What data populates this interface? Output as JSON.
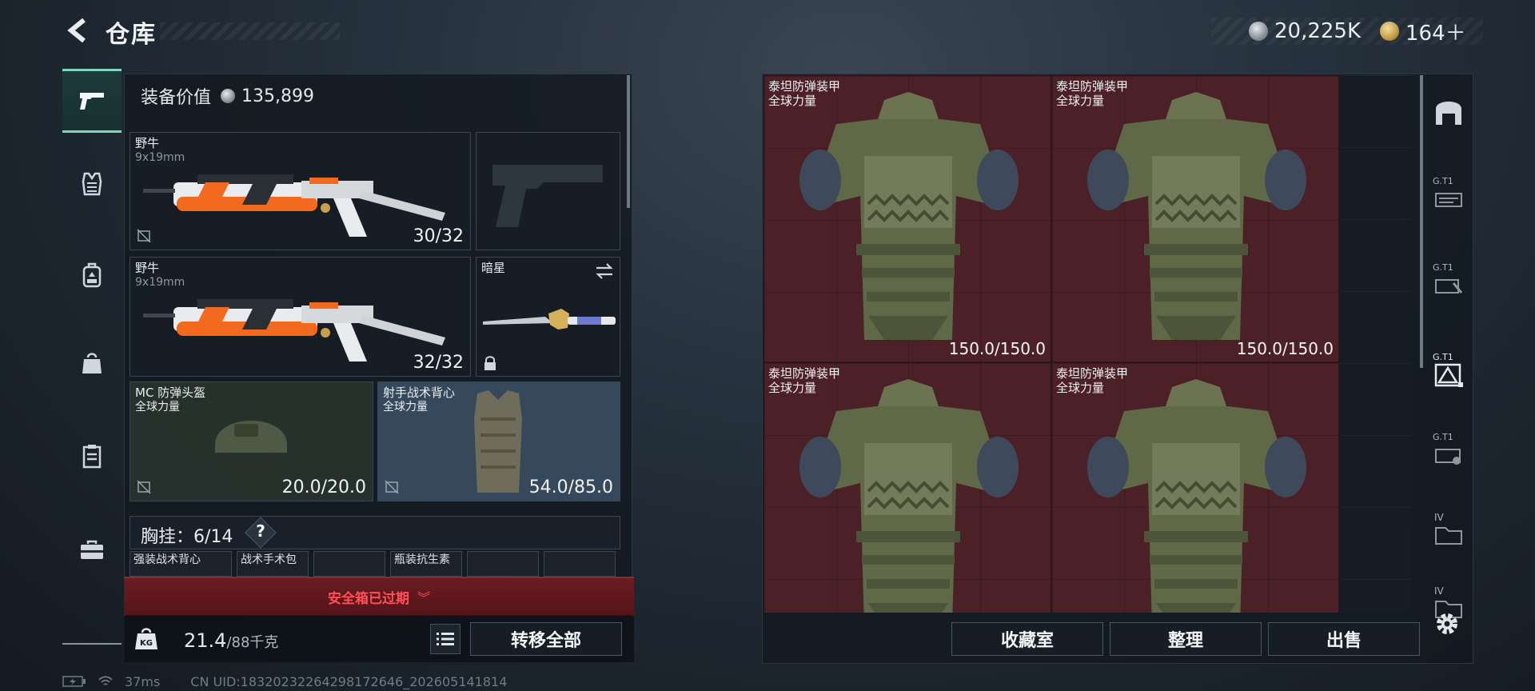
{
  "header": {
    "title": "仓库",
    "currency_primary": "20,225K",
    "currency_secondary": "164＋"
  },
  "left_nav": [
    {
      "name": "weapons-tab",
      "icon": "pistol-icon",
      "active": true
    },
    {
      "name": "armor-tab",
      "icon": "vest-icon",
      "active": false
    },
    {
      "name": "backpack-tab",
      "icon": "backpack-icon",
      "active": false
    },
    {
      "name": "bag-tab",
      "icon": "bag-icon",
      "active": false
    },
    {
      "name": "container-tab",
      "icon": "container-icon",
      "active": false
    },
    {
      "name": "toolbox-tab",
      "icon": "toolbox-icon",
      "active": false
    }
  ],
  "equipment": {
    "value_label": "装备价值",
    "value": "135,899",
    "primary_weapon": {
      "name": "野牛",
      "caliber": "9x19mm",
      "ammo": "30/32"
    },
    "secondary_weapon": {
      "name": "野牛",
      "caliber": "9x19mm",
      "ammo": "32/32"
    },
    "melee": {
      "name": "暗星"
    },
    "helmet": {
      "name": "MC 防弹头盔",
      "brand": "全球力量",
      "durability": "20.0/20.0"
    },
    "armor": {
      "name": "射手战术背心",
      "brand": "全球力量",
      "durability": "54.0/85.0"
    },
    "chest_rig": {
      "label": "胸挂：",
      "capacity": "6/14",
      "help": "?"
    },
    "chest_items": [
      "强装战术背心",
      "战术手术包",
      "",
      "瓶装抗生素",
      "",
      ""
    ]
  },
  "safebox": {
    "status": "安全箱已过期"
  },
  "inventory_footer": {
    "weight": "21.4",
    "weight_max": "/88千克",
    "transfer_all": "转移全部"
  },
  "storage_grid": [
    {
      "name": "泰坦防弹装甲",
      "brand": "全球力量",
      "durability": "150.0/150.0"
    },
    {
      "name": "泰坦防弹装甲",
      "brand": "全球力量",
      "durability": "150.0/150.0"
    },
    {
      "name": "泰坦防弹装甲",
      "brand": "全球力量",
      "durability": ""
    },
    {
      "name": "泰坦防弹装甲",
      "brand": "全球力量",
      "durability": ""
    }
  ],
  "right_nav": [
    {
      "name": "storage-home",
      "icon": "storage-icon",
      "label": ""
    },
    {
      "name": "gt1-weapons",
      "icon": "weapon-rack-icon",
      "label": "G.T1"
    },
    {
      "name": "gt1-tools",
      "icon": "tools-icon",
      "label": "G.T1"
    },
    {
      "name": "gt1-warning",
      "icon": "hazard-icon",
      "label": "G.T1"
    },
    {
      "name": "gt1-misc",
      "icon": "crate-icon",
      "label": "G.T1"
    },
    {
      "name": "iv-folder-1",
      "icon": "folder-icon",
      "label": "IV"
    },
    {
      "name": "iv-folder-2",
      "icon": "folder-icon",
      "label": "IV"
    }
  ],
  "actions": {
    "collection": "收藏室",
    "organize": "整理",
    "sell": "出售"
  },
  "status_bar": {
    "ping": "37ms",
    "uid": "CN UID:18320232264298172646_202605141814"
  },
  "colors": {
    "accent": "#7fd3c0",
    "danger": "#ff5058",
    "storage_cell": "#4b2127"
  }
}
